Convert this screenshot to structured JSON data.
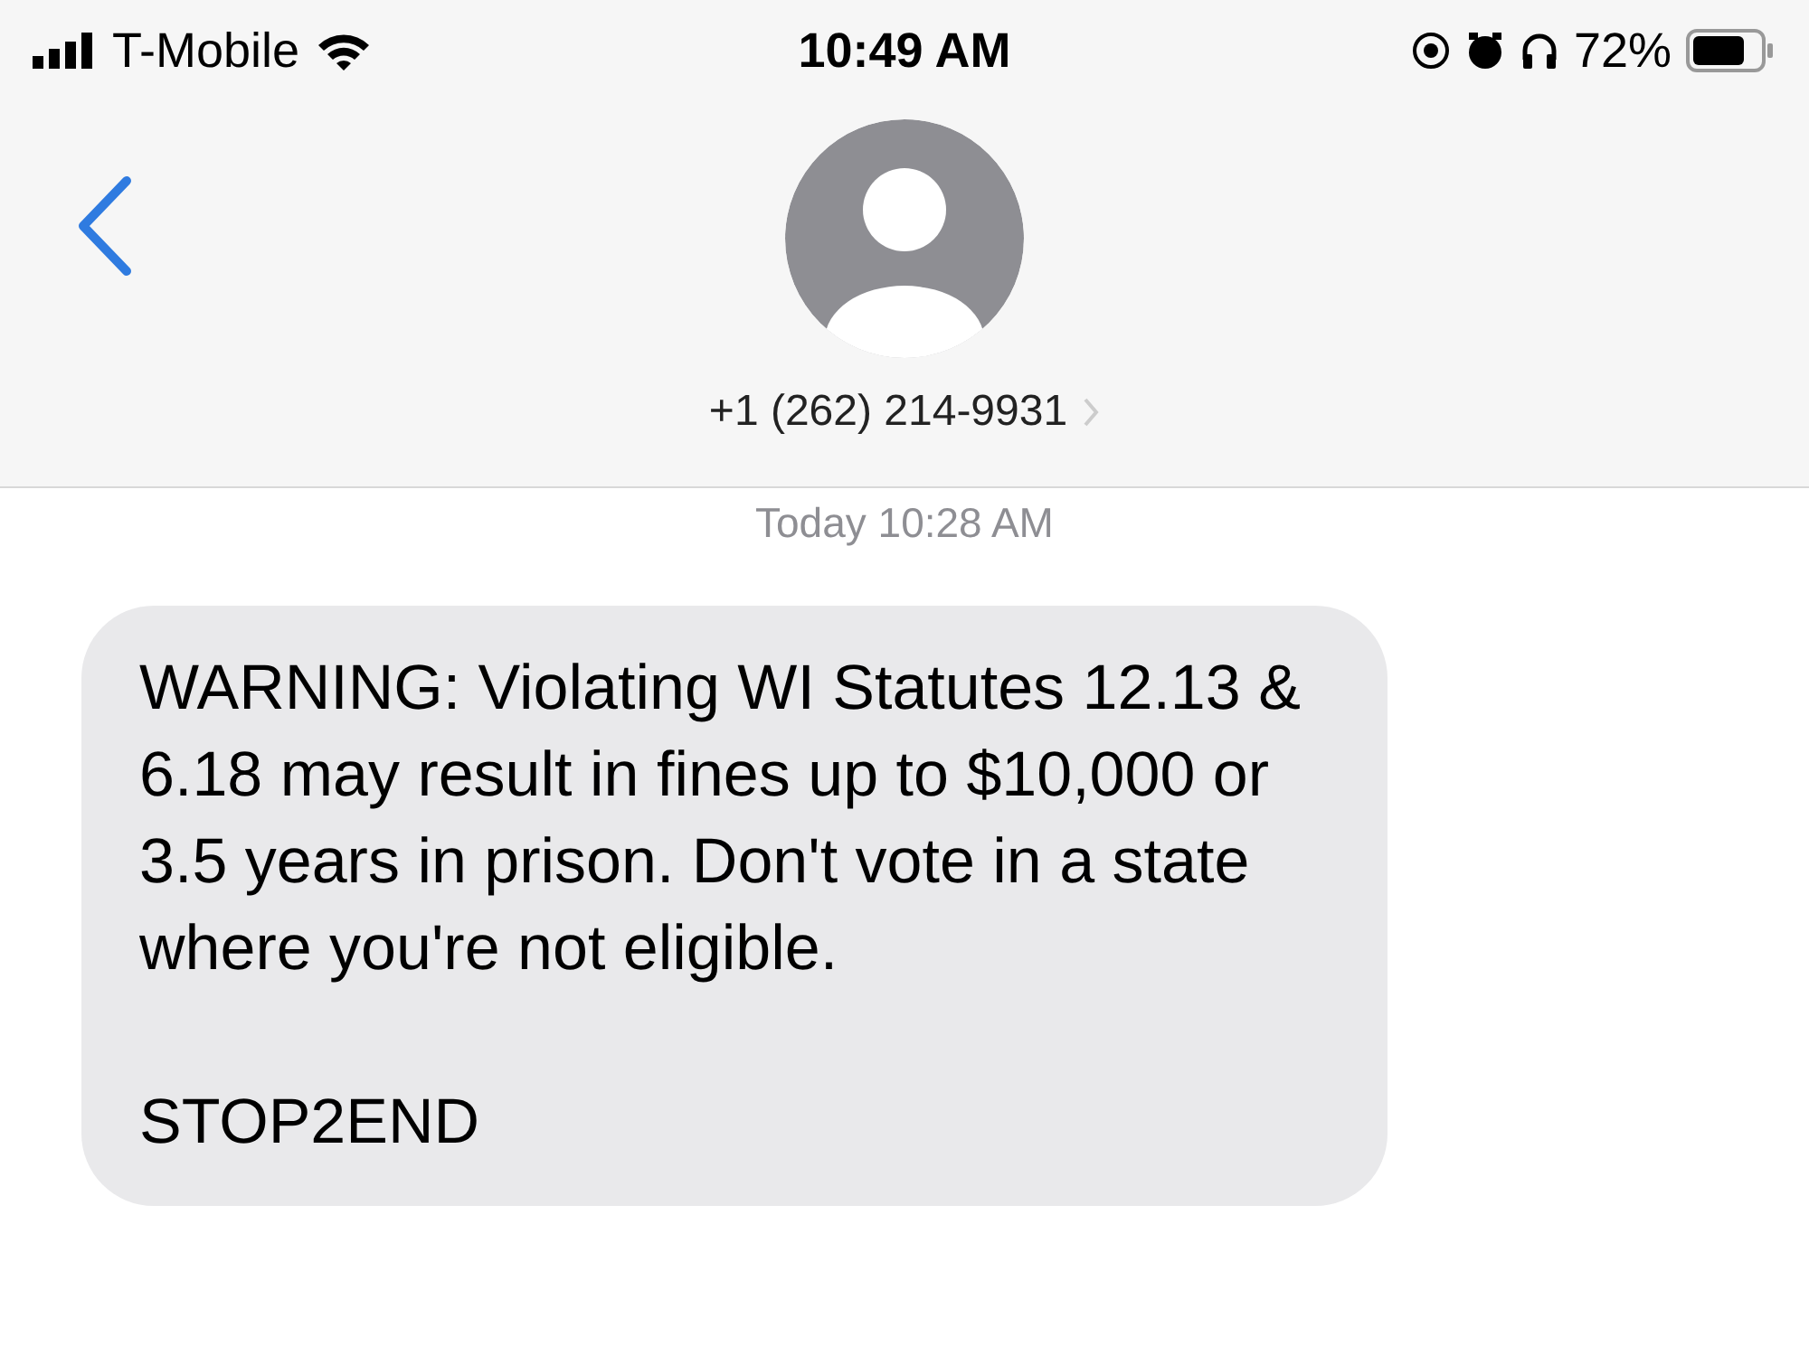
{
  "status_bar": {
    "carrier": "T-Mobile",
    "time": "10:49 AM",
    "battery": "72%"
  },
  "header": {
    "contact": "+1 (262) 214-9931"
  },
  "timestamp": "Today 10:28 AM",
  "messages": [
    {
      "paragraphs": [
        "WARNING: Violating WI Statutes 12.13 & 6.18 may result in fines up to $10,000 or 3.5 years in prison. Don't vote in a state where you're not eligible.",
        "STOP2END"
      ]
    }
  ]
}
